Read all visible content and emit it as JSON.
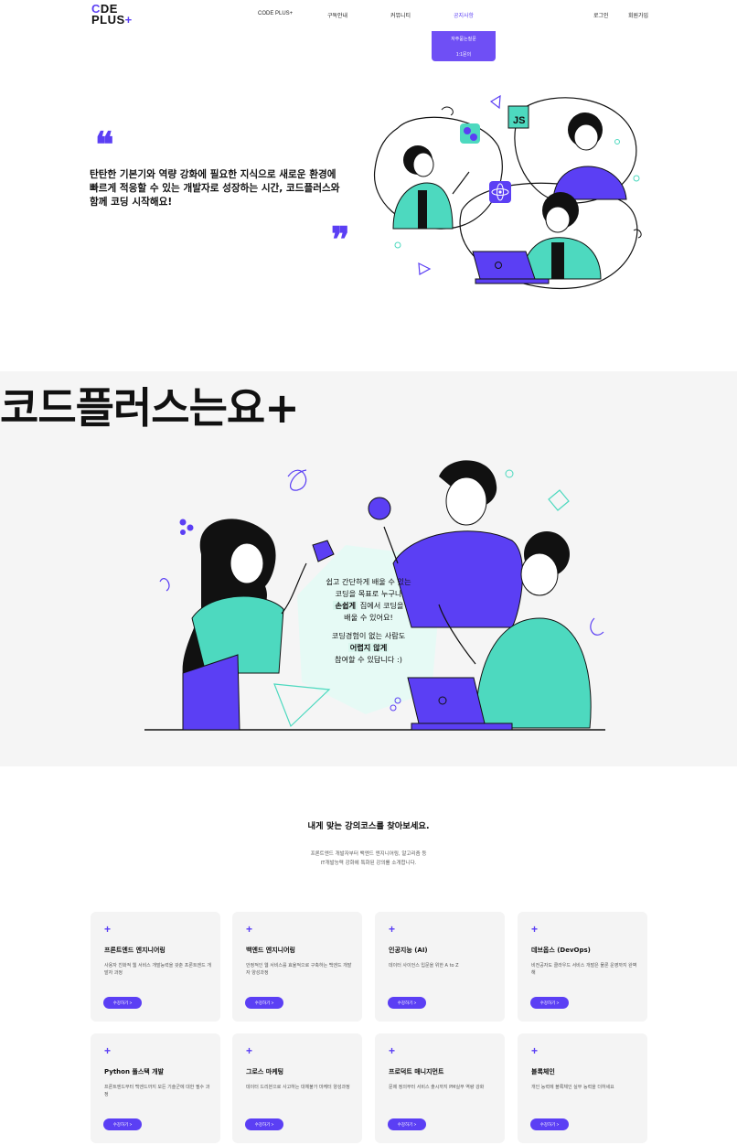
{
  "header": {
    "logo_line1": "C",
    "logo_line1_rest": "DE",
    "logo_line2": "PLUS",
    "logo_plus": "+",
    "nav": [
      "CODE PLUS+",
      "구독안내",
      "커뮤니티",
      "공지사항"
    ],
    "auth": [
      "로그인",
      "회원가입"
    ],
    "dropdown": [
      "자주묻는질문",
      "1:1문의"
    ],
    "active_nav": "공지사항"
  },
  "hero": {
    "quote_open": "❝",
    "quote_close": "❞",
    "lines": [
      "탄탄한 기본기와 역량 강화에 필요한 지식으로 새로운 환경에",
      "빠르게 적응할 수 있는 개발자로 성장하는 시간, 코드플러스와",
      "함께 코딩 시작해요!"
    ]
  },
  "about": {
    "title": "코드플러스는요+",
    "bubble": {
      "l1": "쉽고 간단하게 배울 수 있는",
      "l2": "코딩을 목표로 누구나",
      "l3_hl": "손쉽게",
      "l3_rest": " 집에서 코딩을",
      "l4": "배울 수 있어요!",
      "l5": "코딩경험이 없는 사람도",
      "l6_hl": "어렵지 않게",
      "l7": "참여할 수 있답니다 :)"
    }
  },
  "courses": {
    "heading": "내게 맞는 강의코스를 찾아보세요.",
    "sub1": "프론트엔드 개발자부터 백엔드 엔지니어링, 알고리즘 등",
    "sub2": "IT개발능력 강화에 특화된 강의를 소개합니다.",
    "plus": "+",
    "button_label": "수강하기 >",
    "items": [
      {
        "title": "프론트엔드 엔지니어링",
        "desc": "사용자 친화적 웹 서비스 개발능력을 갖춘 프론트엔드 개발자 과정"
      },
      {
        "title": "백엔드 엔지니어링",
        "desc": "안정적인 웹 서비스를 효율적으로 구축하는 백엔드 개발자 양성과정"
      },
      {
        "title": "인공지능 (AI)",
        "desc": "데이터 사이언스 입문을 위한 A to Z"
      },
      {
        "title": "데브옵스 (DevOps)",
        "desc": "비전공자도 클라우드 서비스 개발은 물론 운영까지 완벽해"
      },
      {
        "title": "Python 풀스택 개발",
        "desc": "프론트엔드부터 백엔드까지 모든 기술군에 대한 필수 과정"
      },
      {
        "title": "그로스 마케팅",
        "desc": "데이터 드리븐으로 사고하는 대체불가 마케터 양성과정"
      },
      {
        "title": "프로덕트 매니지먼트",
        "desc": "문제 정의부터 서비스 출시까지 PM실무 역량 강화"
      },
      {
        "title": "블록체인",
        "desc": "개인 능력에 블록체인 실무 능력을 더하세요"
      }
    ]
  },
  "colors": {
    "accent": "#5b3ff4",
    "mint": "#4dd9bf",
    "bg_light": "#f5f5f5"
  }
}
